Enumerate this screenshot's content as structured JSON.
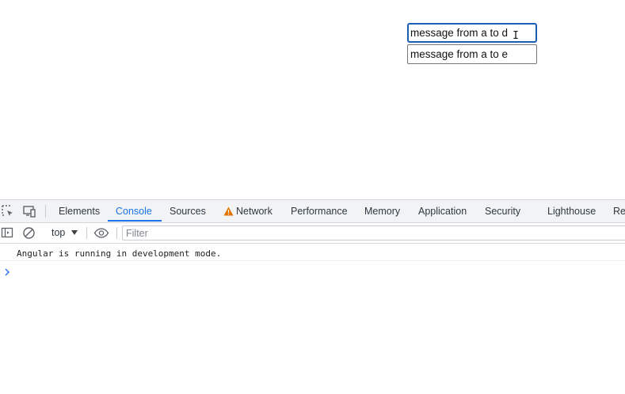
{
  "page": {
    "input_a_value": "message from a to d",
    "input_b_value": "message from a to e",
    "text_cursor_glyph": "I"
  },
  "devtools": {
    "tabs": [
      {
        "label": "Elements",
        "active": false
      },
      {
        "label": "Console",
        "active": true
      },
      {
        "label": "Sources",
        "active": false
      },
      {
        "label": "Network",
        "active": false,
        "icon": "warning-icon"
      },
      {
        "label": "Performance",
        "active": false
      },
      {
        "label": "Memory",
        "active": false
      },
      {
        "label": "Application",
        "active": false
      },
      {
        "label": "Security",
        "active": false
      },
      {
        "label": "Lighthouse",
        "active": false
      },
      {
        "label": "Re",
        "active": false
      }
    ],
    "toolbar": {
      "context_label": "top",
      "filter_placeholder": "Filter"
    },
    "console": {
      "messages": [
        "Angular is running in development mode."
      ]
    },
    "colors": {
      "accent": "#1a73e8",
      "warning": "#e37400"
    }
  }
}
